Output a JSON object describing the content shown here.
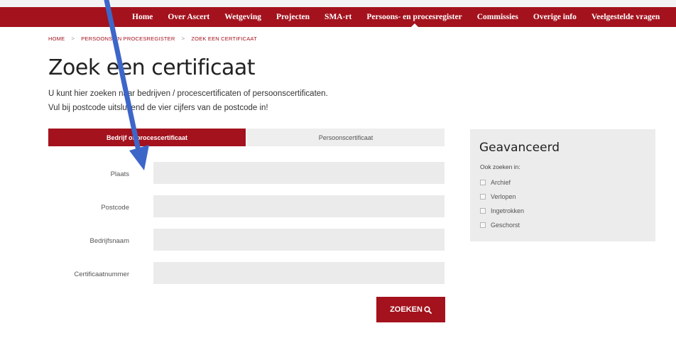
{
  "nav": {
    "items": [
      {
        "label": "Home"
      },
      {
        "label": "Over Ascert"
      },
      {
        "label": "Wetgeving"
      },
      {
        "label": "Projecten"
      },
      {
        "label": "SMA-rt"
      },
      {
        "label": "Persoons- en procesregister",
        "active": true
      },
      {
        "label": "Commissies"
      },
      {
        "label": "Overige info"
      },
      {
        "label": "Veelgestelde vragen"
      }
    ]
  },
  "breadcrumb": {
    "items": [
      "HOME",
      "PERSOONS EN PROCESREGISTER",
      "ZOEK EEN CERTIFICAAT"
    ],
    "separator": ">"
  },
  "page": {
    "title": "Zoek een certificaat",
    "intro_line1": "U kunt hier zoeken naar bedrijven / procescertificaten of persoonscertificaten.",
    "intro_line2": "Vul bij postcode uitsluitend de vier cijfers van de postcode in!"
  },
  "tabs": {
    "bedrijf": "Bedrijf of procescertificaat",
    "persoon": "Persoonscertificaat"
  },
  "form": {
    "plaats_label": "Plaats",
    "plaats_value": "",
    "postcode_label": "Postcode",
    "postcode_value": "",
    "bedrijfsnaam_label": "Bedrijfsnaam",
    "bedrijfsnaam_value": "",
    "certificaatnummer_label": "Certificaatnummer",
    "certificaatnummer_value": "",
    "submit_label": "ZOEKEN"
  },
  "advanced": {
    "title": "Geavanceerd",
    "subtitle": "Ook zoeken in:",
    "options": [
      {
        "label": "Archief",
        "checked": false
      },
      {
        "label": "Verlopen",
        "checked": false
      },
      {
        "label": "Ingetrokken",
        "checked": false
      },
      {
        "label": "Geschorst",
        "checked": false
      }
    ]
  },
  "colors": {
    "brand_red": "#a3121d",
    "input_bg": "#ebebeb",
    "panel_bg": "#ececec",
    "annotation_arrow": "#3d66c9"
  },
  "icons": {
    "search_button_icon": "magnifier-icon"
  }
}
